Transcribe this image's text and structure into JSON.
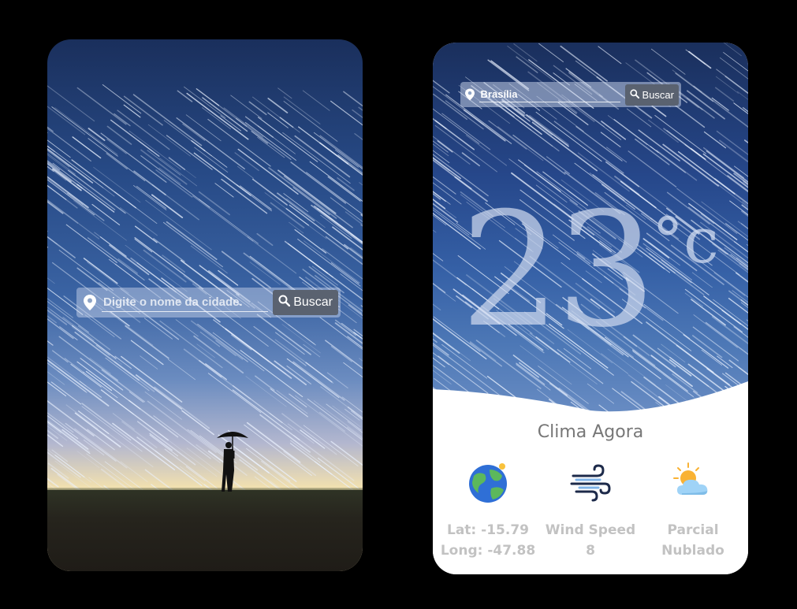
{
  "left_screen": {
    "search": {
      "placeholder": "Digite o nome da cidade.",
      "button_label": "Buscar"
    }
  },
  "right_screen": {
    "search": {
      "value": "Brasília",
      "button_label": "Buscar"
    },
    "temperature": "23",
    "unit": "°c",
    "section_title": "Clima Agora",
    "info": {
      "location": {
        "lat": "Lat: -15.79",
        "long": "Long: -47.88",
        "icon": "earth-icon"
      },
      "wind": {
        "label": "Wind Speed",
        "value": "8",
        "icon": "wind-icon"
      },
      "condition": {
        "line1": "Parcial",
        "line2": "Nublado",
        "icon": "partly-cloudy-icon"
      }
    }
  },
  "colors": {
    "text_muted": "#c2c2c2",
    "title": "#777777",
    "button_bg": "#5a6270"
  }
}
